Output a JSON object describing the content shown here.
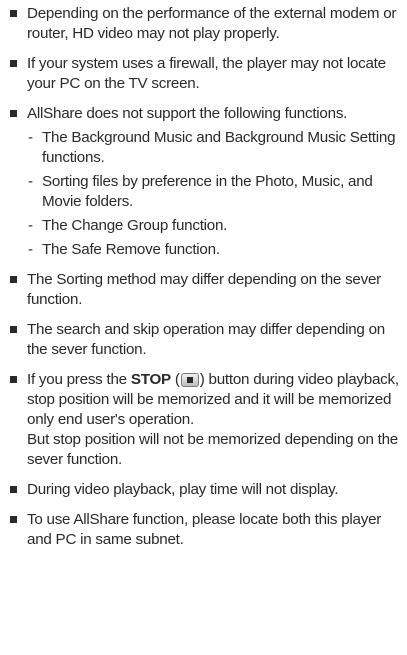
{
  "items": [
    {
      "text": "Depending on the performance of the external modem or router, HD video may not play properly."
    },
    {
      "text": "If your system uses a firewall, the player may not locate your PC on the TV screen."
    },
    {
      "text": "AllShare does not support the following functions.",
      "dash": "-",
      "subitems": [
        "The Background Music and Background Music Setting functions.",
        "Sorting files by preference in the Photo, Music, and Movie folders.",
        "The Change Group function.",
        "The Safe Remove function."
      ]
    },
    {
      "text": "The Sorting method may differ depending on the sever function."
    },
    {
      "text": "The search and skip operation may differ depending on the sever function."
    },
    {
      "prefix": "If you press the",
      "button_label": "STOP",
      "open_paren": "(",
      "button_icon": "stop-button-icon",
      "close_paren": ")",
      "suffix": "button during video playback, stop position will be memorized and it will be memorized only end user's operation.",
      "line2": "But stop position will not be memorized depending on the sever function."
    },
    {
      "text": "During video playback, play time will not display."
    },
    {
      "text": "To use AllShare function, please locate both this player and PC in same subnet."
    }
  ]
}
